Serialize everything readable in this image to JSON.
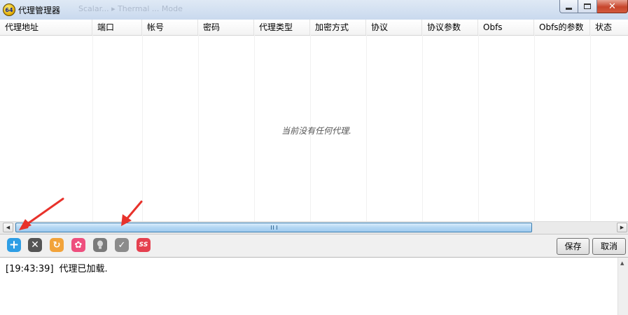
{
  "window": {
    "title": "代理管理器",
    "app_icon_text": "64",
    "ghost_title": "Scalar... ▸ Thermal ... Mode",
    "close_glyph": "✕"
  },
  "table": {
    "columns": [
      "代理地址",
      "端口",
      "帐号",
      "密码",
      "代理类型",
      "加密方式",
      "协议",
      "协议参数",
      "Obfs",
      "Obfs的参数",
      "状态"
    ],
    "rows": [],
    "empty_message": "当前没有任何代理."
  },
  "toolbar": {
    "icons": [
      "add-icon",
      "delete-icon",
      "refresh-icon",
      "settings-icon",
      "bulb-icon",
      "check-icon",
      "ss-icon"
    ],
    "ss_label": "SS",
    "save_label": "保存",
    "cancel_label": "取消"
  },
  "log": {
    "entries": [
      {
        "time": "[19:43:39]",
        "message": "代理已加载."
      }
    ]
  },
  "colors": {
    "accent": "#2e9ee5",
    "annotation": "#e8322b",
    "scrollbar_thumb": "#b4d7f3"
  }
}
